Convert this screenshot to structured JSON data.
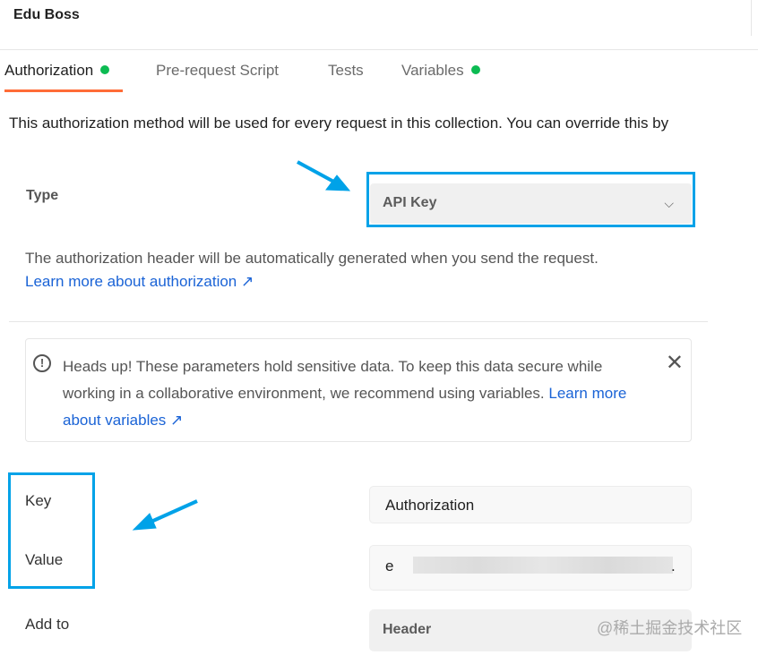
{
  "collection": {
    "title": "Edu Boss"
  },
  "tabs": [
    {
      "label": "Authorization",
      "active": true,
      "dot": true
    },
    {
      "label": "Pre-request Script"
    },
    {
      "label": "Tests"
    },
    {
      "label": "Variables",
      "dot": true
    }
  ],
  "auth": {
    "description": "This authorization method will be used for every request in this collection. You can override this by",
    "type_label": "Type",
    "type_value": "API Key",
    "help_text": "The authorization header will be automatically generated when you send the request.",
    "help_link": "Learn more about authorization ↗",
    "alert": {
      "text": "Heads up! These parameters hold sensitive data. To keep this data secure while working in a collaborative environment, we recommend using variables.",
      "link": "Learn more about variables ↗"
    },
    "key_label": "Key",
    "key_value": "Authorization",
    "value_label": "Value",
    "value_prefix": "e",
    "value_suffix": ".",
    "addto_label": "Add to",
    "addto_value": "Header"
  },
  "watermark": "@稀土掘金技术社区",
  "colors": {
    "accent": "#ff6c37",
    "dot": "#0cbb52",
    "annotation": "#00a2e8",
    "link": "#1a63d6"
  }
}
